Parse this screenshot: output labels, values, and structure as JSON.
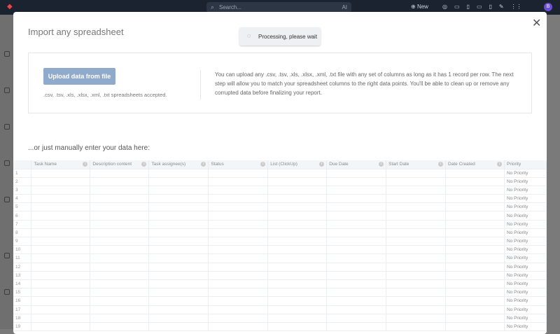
{
  "topbar": {
    "search_placeholder": "Search...",
    "ai_label": "AI",
    "new_label": "New",
    "avatar": "B"
  },
  "modal": {
    "title": "Import any spreadsheet",
    "toast": "Processing, please wait",
    "upload_button": "Upload data from file",
    "accepted": ".csv, .tsv, .xls, .xlsx, .xml, .txt spreadsheets accepted.",
    "description": "You can upload any .csv, .tsv, .xls, .xlsx, .xml, .txt file with any set of columns as long as it has 1 record per row. The next step will allow you to match your spreadsheet columns to the right data points. You'll be able to clean up or remove any corrupted data before finalizing your report.",
    "manual_label": "...or just manually enter your data here:",
    "columns": [
      "Task Name",
      "Description content",
      "Task assignee(s)",
      "Status",
      "List (ClickUp)",
      "Due Date",
      "Start Date",
      "Date Created",
      "Priority"
    ],
    "default_priority": "No Priority",
    "row_count": 19
  }
}
